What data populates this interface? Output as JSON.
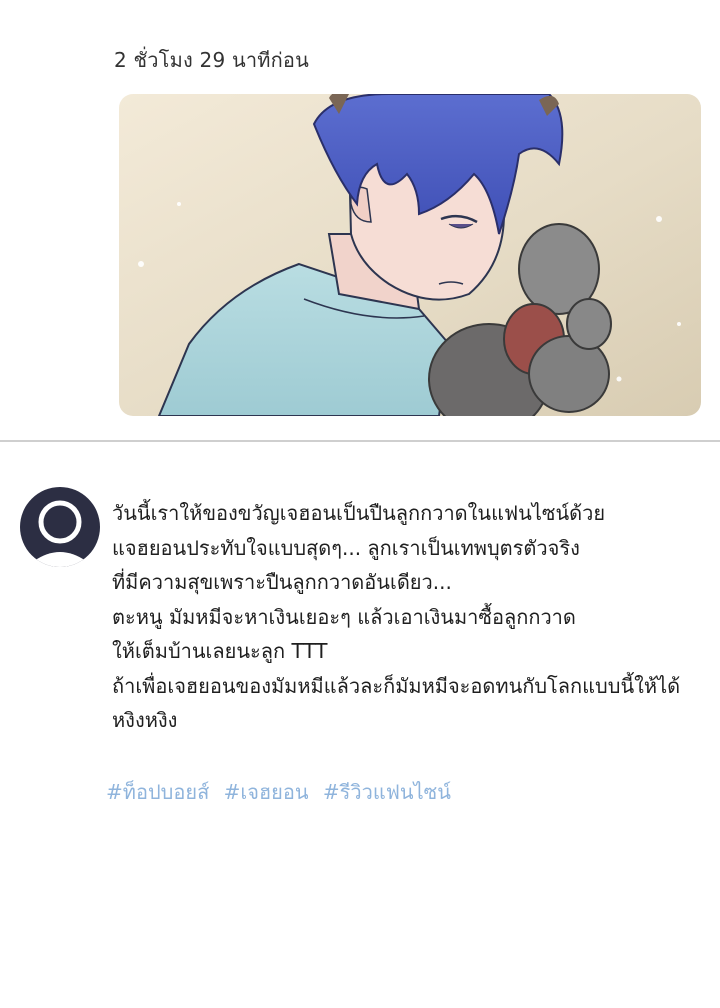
{
  "post": {
    "timestamp": "2 ชั่วโมง 29 นาทีก่อน",
    "image_icon": "illustration-blue-haired-man-holding-plush"
  },
  "comment": {
    "avatar_icon": "user-avatar-icon",
    "lines": [
      "วันนี้เราให้ของขวัญเจฮอนเป็นปืนลูกกวาดในแฟนไซน์ด้วย",
      "แจฮยอนประทับใจแบบสุดๆ... ลูกเราเป็นเทพบุตรตัวจริง",
      "ที่มีความสุขเพราะปืนลูกกวาดอันเดียว...",
      "ตะหนู มัมหมีจะหาเงินเยอะๆ แล้วเอาเงินมาซื้อลูกกวาด",
      "ให้เต็มบ้านเลยนะลูก TTT",
      "ถ้าเพื่อเจฮยอนของมัมหมีแล้วละก็มัมหมีจะอดทนกับโลกแบบนี้ให้ได้",
      "หงิงหงิง"
    ],
    "hashtags": [
      "#ท็อปบอยส์",
      "#เจฮยอน",
      "#รีวิวแฟนไซน์"
    ]
  },
  "colors": {
    "hashtag": "#8fb4dc",
    "avatar_bg": "#2c2e43",
    "divider": "#cfcfcf"
  }
}
